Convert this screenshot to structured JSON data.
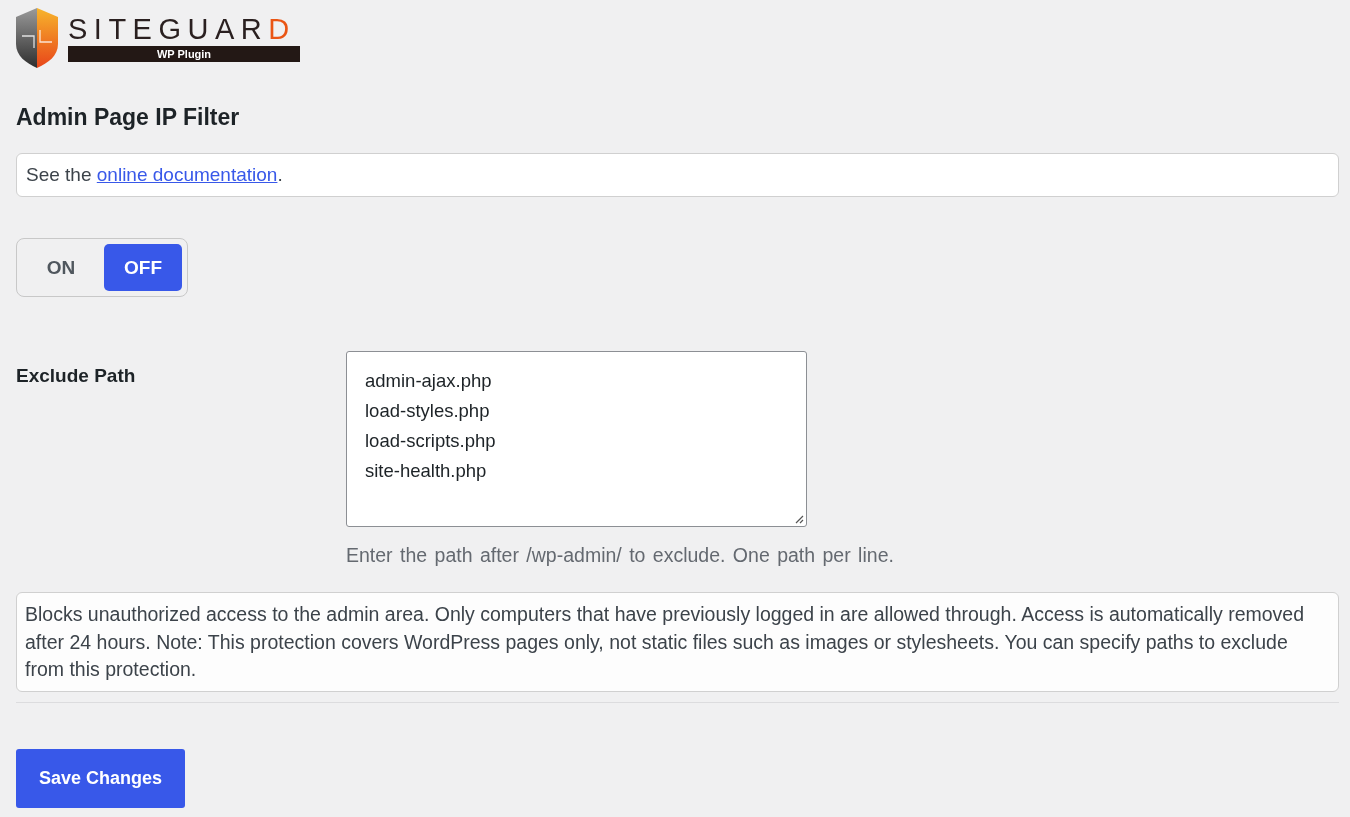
{
  "logo": {
    "name": "SITEGUARD",
    "tagline": "WP Plugin"
  },
  "heading": "Admin Page IP Filter",
  "doc_notice": {
    "before": "See the ",
    "link": "online documentation",
    "after": "."
  },
  "toggle": [
    {
      "label": "ON",
      "selected": false
    },
    {
      "label": "OFF",
      "selected": true
    }
  ],
  "exclude_path": {
    "label": "Exclude Path",
    "value": [
      "admin-ajax.php",
      "load-styles.php",
      "load-scripts.php",
      "site-health.php"
    ],
    "hint": "Enter the path after /wp-admin/ to exclude. One path per line."
  },
  "description": "Blocks unauthorized access to the admin area. Only computers that have previously logged in are allowed through. Access is automatically removed after 24 hours. Note: This protection covers WordPress pages only, not static files such as images or stylesheets. You can specify paths to exclude from this protection.",
  "save_button": "Save Changes"
}
